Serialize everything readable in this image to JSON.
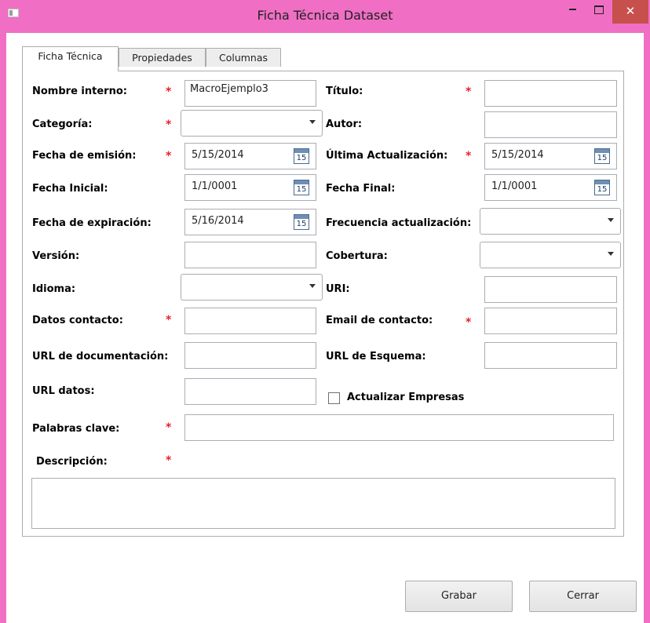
{
  "window": {
    "title": "Ficha Técnica Dataset",
    "close_glyph": "✕",
    "colors": {
      "frame": "#f06fc4",
      "close_button": "#c7504d",
      "required_mark": "#e8202a"
    }
  },
  "tabs": [
    "Ficha Técnica",
    "Propiedades",
    "Columnas"
  ],
  "active_tab": 0,
  "required_mark": "*",
  "fields": {
    "nombre_interno": {
      "label": "Nombre interno:",
      "value": "MacroEjemplo3"
    },
    "titulo": {
      "label": "Título:",
      "value": ""
    },
    "categoria": {
      "label": "Categoría:",
      "value": ""
    },
    "autor": {
      "label": "Autor:",
      "value": ""
    },
    "fecha_emision": {
      "label": "Fecha de emisión:",
      "value": "5/15/2014",
      "calendar_day": "15"
    },
    "ultima_actualizacion": {
      "label": "Última Actualización:",
      "value": "5/15/2014",
      "calendar_day": "15"
    },
    "fecha_inicial": {
      "label": "Fecha Inicial:",
      "value": "1/1/0001",
      "calendar_day": "15"
    },
    "fecha_final": {
      "label": "Fecha Final:",
      "value": "1/1/0001",
      "calendar_day": "15"
    },
    "fecha_expiracion": {
      "label": "Fecha de expiración:",
      "value": "5/16/2014",
      "calendar_day": "15"
    },
    "frecuencia": {
      "label": "Frecuencia actualización:",
      "value": ""
    },
    "version": {
      "label": "Versión:",
      "value": ""
    },
    "cobertura": {
      "label": "Cobertura:",
      "value": ""
    },
    "idioma": {
      "label": "Idioma:",
      "value": ""
    },
    "uri": {
      "label": "URI:",
      "value": ""
    },
    "datos_contacto": {
      "label": "Datos contacto:",
      "value": ""
    },
    "email_contacto": {
      "label": "Email de contacto:",
      "value": ""
    },
    "url_documentacion": {
      "label": "URL de documentación:",
      "value": ""
    },
    "url_esquema": {
      "label": "URL de Esquema:",
      "value": ""
    },
    "url_datos": {
      "label": "URL datos:",
      "value": ""
    },
    "actualizar_empresas": {
      "label": "Actualizar Empresas",
      "checked": false
    },
    "palabras_clave": {
      "label": "Palabras clave:",
      "value": ""
    },
    "descripcion": {
      "label": "Descripción:",
      "value": ""
    }
  },
  "buttons": {
    "grabar": "Grabar",
    "cerrar": "Cerrar"
  }
}
